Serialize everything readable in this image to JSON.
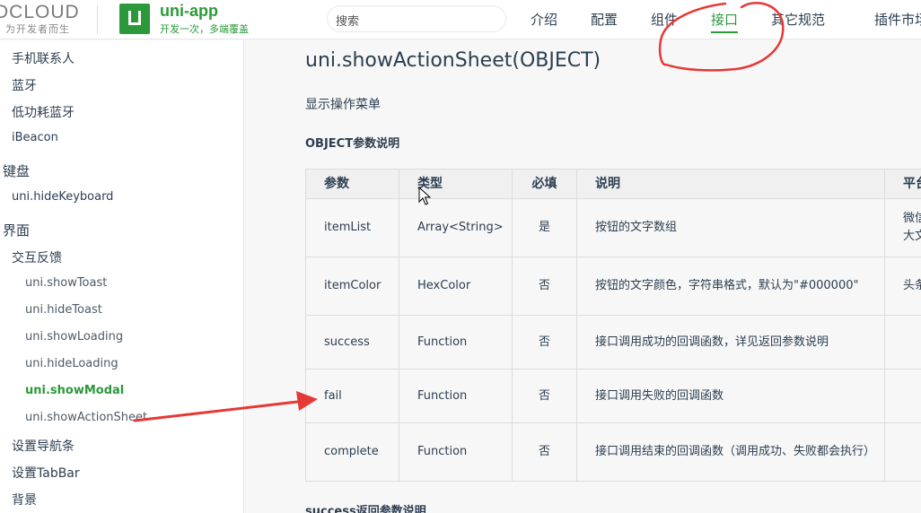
{
  "header": {
    "dcloud_logo": "DCLOUD",
    "dcloud_slogan": "为开发者而生",
    "uniapp_title": "uni-app",
    "uniapp_slogan": "开发一次，多端覆盖",
    "search_placeholder": "搜索",
    "nav": [
      "介绍",
      "配置",
      "组件",
      "接口",
      "其它规范",
      "插件市场"
    ],
    "active_nav": "接口",
    "accent_color": "#2b9939"
  },
  "sidebar": {
    "items": [
      {
        "label": "手机联系人",
        "level": 1
      },
      {
        "label": "蓝牙",
        "level": 1
      },
      {
        "label": "低功耗蓝牙",
        "level": 1
      },
      {
        "label": "iBeacon",
        "level": 1
      },
      {
        "label": "键盘",
        "level": 0
      },
      {
        "label": "uni.hideKeyboard",
        "level": 1
      },
      {
        "label": "界面",
        "level": 0
      },
      {
        "label": "交互反馈",
        "level": 1
      },
      {
        "label": "uni.showToast",
        "level": 2
      },
      {
        "label": "uni.hideToast",
        "level": 2
      },
      {
        "label": "uni.showLoading",
        "level": 2
      },
      {
        "label": "uni.hideLoading",
        "level": 2
      },
      {
        "label": "uni.showModal",
        "level": 2,
        "active": true
      },
      {
        "label": "uni.showActionSheet",
        "level": 2
      },
      {
        "label": "设置导航条",
        "level": 1
      },
      {
        "label": "设置TabBar",
        "level": 1
      },
      {
        "label": "背景",
        "level": 1
      }
    ]
  },
  "main": {
    "title": "uni.showActionSheet(OBJECT)",
    "description": "显示操作菜单",
    "params_title": "OBJECT参数说明",
    "success_title": "success返回参数说明",
    "table": {
      "headers": [
        "参数",
        "类型",
        "必填",
        "说明",
        "平台差异说明"
      ],
      "rows": [
        {
          "name": "itemList",
          "type": "Array<String>",
          "required": "是",
          "desc": "按钮的文字数组",
          "platform": [
            "微信",
            "大文"
          ]
        },
        {
          "name": "itemColor",
          "type": "HexColor",
          "required": "否",
          "desc": "按钮的文字颜色，字符串格式，默认为\"#000000\"",
          "platform": [
            "头条"
          ]
        },
        {
          "name": "success",
          "type": "Function",
          "required": "否",
          "desc": "接口调用成功的回调函数，详见返回参数说明",
          "platform": []
        },
        {
          "name": "fail",
          "type": "Function",
          "required": "否",
          "desc": "接口调用失败的回调函数",
          "platform": []
        },
        {
          "name": "complete",
          "type": "Function",
          "required": "否",
          "desc": "接口调用结束的回调函数（调用成功、失败都会执行）",
          "platform": []
        }
      ]
    }
  },
  "annotations": {
    "stroke_color": "#e53935"
  }
}
